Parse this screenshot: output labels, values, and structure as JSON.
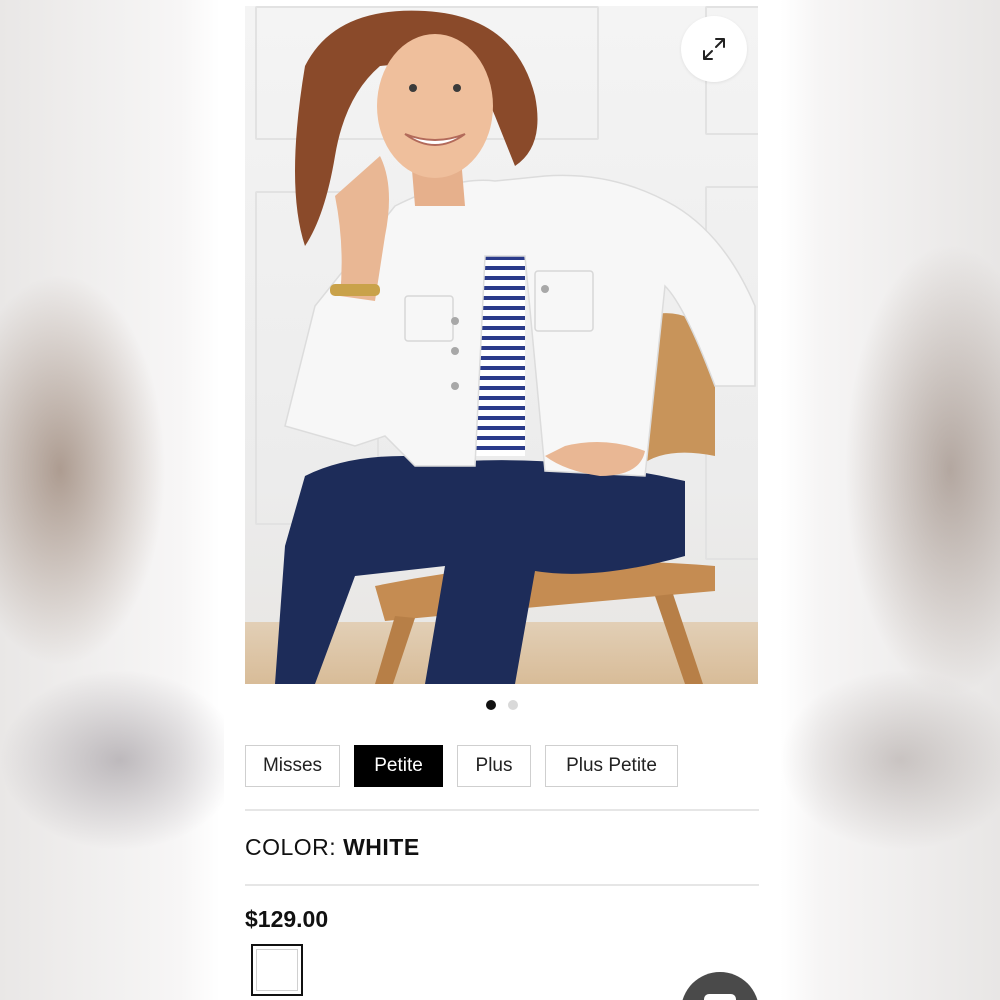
{
  "gallery": {
    "image_alt": "Model in white denim jacket, striped tee and dark jeans seated on a wooden chair",
    "active_index": 0,
    "total": 2,
    "expand_icon": "expand-arrows-icon"
  },
  "sizes": {
    "options": [
      "Misses",
      "Petite",
      "Plus",
      "Plus Petite"
    ],
    "selected": "Petite"
  },
  "color": {
    "label": "COLOR:",
    "value": "WHITE",
    "swatch_hex": "#ffffff"
  },
  "price": "$129.00",
  "chat": {
    "icon": "chat-icon"
  },
  "colors": {
    "selected_bg": "#000000",
    "divider": "#e6e6e6",
    "chat_bg": "#4a4a4a"
  }
}
